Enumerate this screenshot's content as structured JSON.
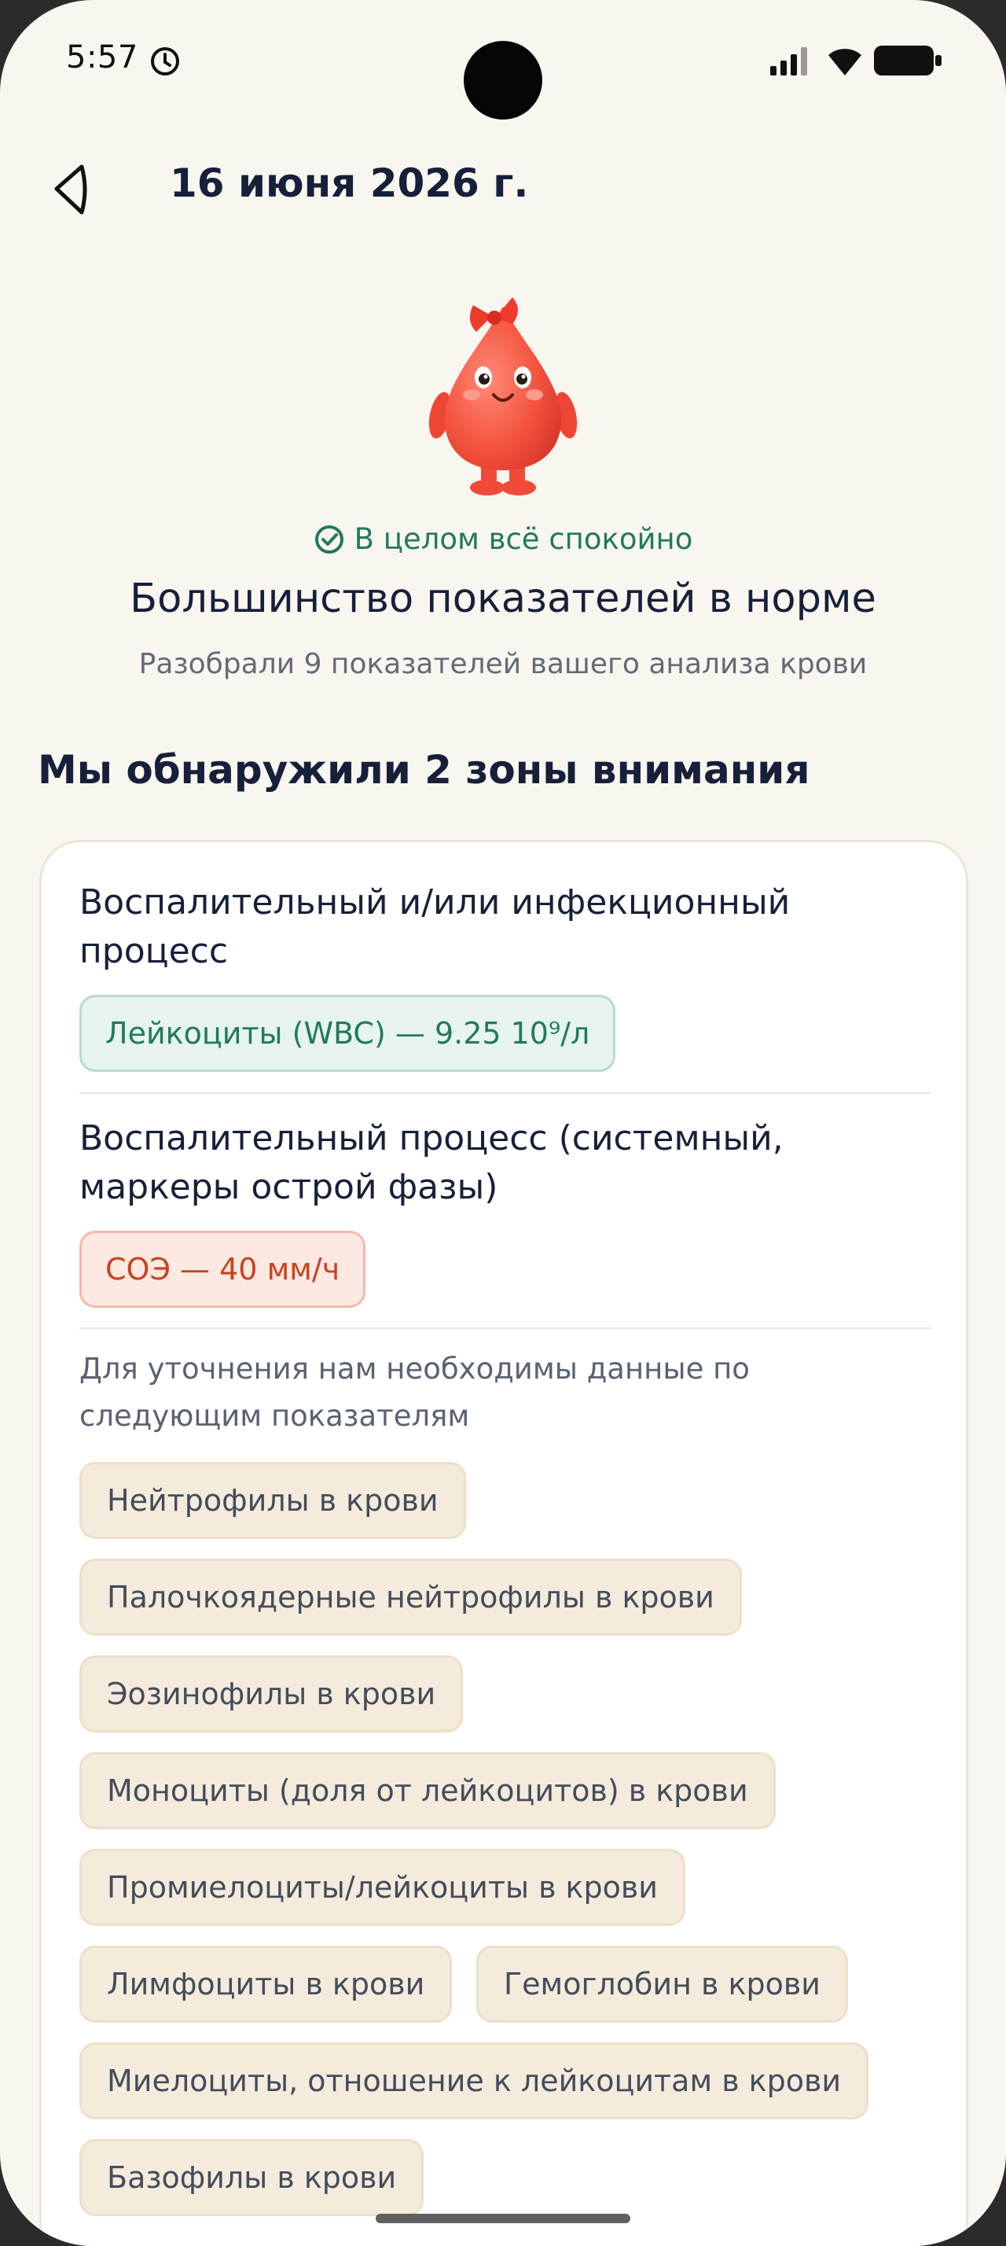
{
  "status_bar": {
    "time": "5:57",
    "icons": [
      "alarm-icon",
      "signal-icon",
      "wifi-icon",
      "battery-icon"
    ]
  },
  "header": {
    "back_icon": "back-arrow-icon",
    "title": "16 июня 2026 г."
  },
  "summary": {
    "mascot": "blood-drop-mascot",
    "status_text": "В целом всё спокойно",
    "status_icon": "check-circle-icon",
    "title": "Большинство показателей в норме",
    "subtitle": "Разобрали 9 показателей вашего анализа крови"
  },
  "zones": {
    "heading": "Мы обнаружили 2 зоны внимания",
    "items": [
      {
        "title": "Воспалительный и/или инфекционный процесс",
        "chip": "Лейкоциты (WBC) — 9.25 10⁹/л",
        "status": "green"
      },
      {
        "title": "Воспалительный процесс (системный, маркеры острой фазы)",
        "chip": "СОЭ — 40 мм/ч",
        "status": "red"
      }
    ],
    "needed_text": "Для уточнения нам необходимы данные по следующим показателям",
    "needed_tags": [
      "Нейтрофилы в крови",
      "Палочкоядерные нейтрофилы в крови",
      "Эозинофилы в крови",
      "Моноциты (доля от лейкоцитов) в крови",
      "Промиелоциты/лейкоциты в крови",
      "Лимфоциты в крови",
      "Гемоглобин в крови",
      "Миелоциты, отношение к лейкоцитам в крови",
      "Базофилы в крови"
    ]
  },
  "colors": {
    "background": "#f9f6f0",
    "title": "#17203a",
    "ok_green": "#217a5c",
    "alert_red": "#c9421c",
    "tag_bg": "#f4ebdc"
  }
}
